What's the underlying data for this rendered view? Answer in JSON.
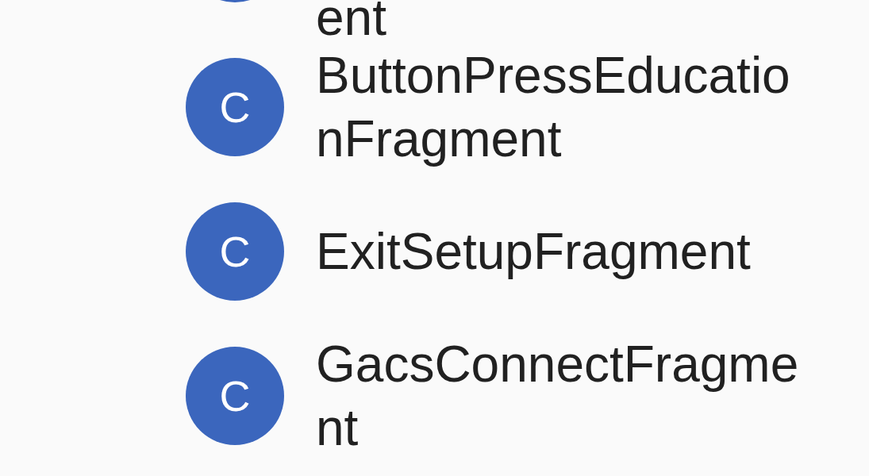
{
  "partial_item": {
    "name": "ent"
  },
  "items": [
    {
      "icon_letter": "C",
      "name": "ButtonPressEducationFragment"
    },
    {
      "icon_letter": "C",
      "name": "ExitSetupFragment"
    },
    {
      "icon_letter": "C",
      "name": "GacsConnectFragment"
    }
  ]
}
